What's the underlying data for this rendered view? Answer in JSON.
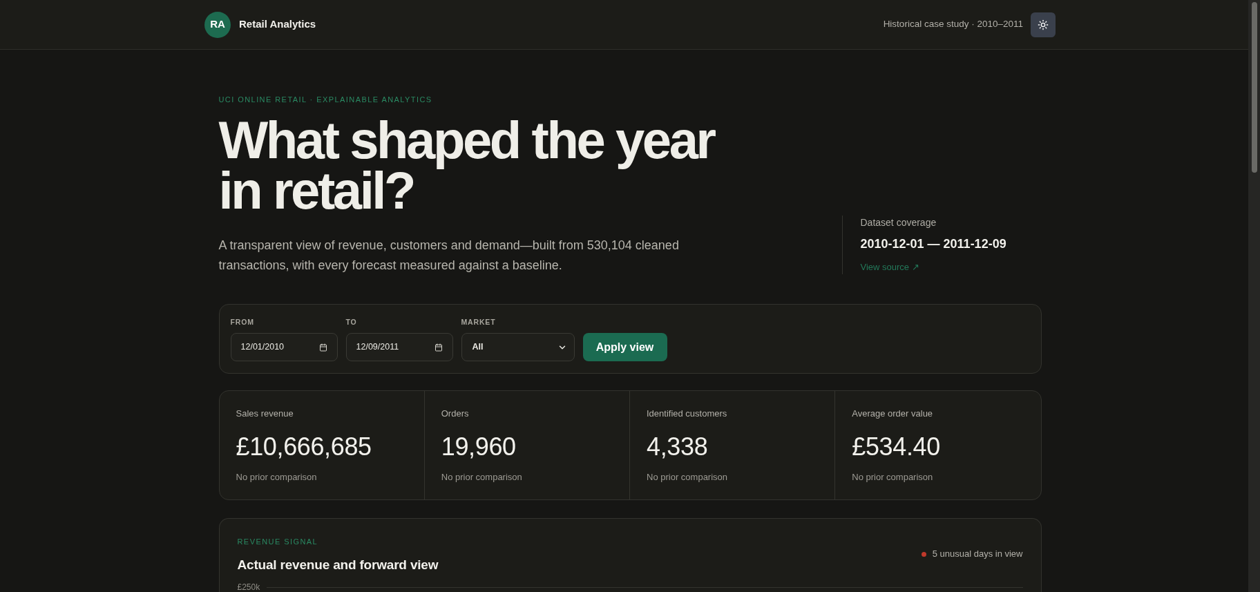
{
  "header": {
    "logo": "RA",
    "brand": "Retail Analytics",
    "case_study": "Historical case study · 2010–2011"
  },
  "hero": {
    "eyebrow": "UCI ONLINE RETAIL · EXPLAINABLE ANALYTICS",
    "headline": "What shaped the year in retail?",
    "description": "A transparent view of revenue, customers and demand—built from 530,104 cleaned transactions, with every forecast measured against a baseline."
  },
  "coverage": {
    "label": "Dataset coverage",
    "range": "2010-12-01 — 2011-12-09",
    "link": "View source ↗"
  },
  "filters": {
    "fields": [
      {
        "kind": "date",
        "label": "FROM",
        "value": "12/01/2010"
      },
      {
        "kind": "date",
        "label": "TO",
        "value": "12/09/2011"
      },
      {
        "kind": "select",
        "label": "MARKET",
        "value": "All"
      }
    ],
    "button": "Apply view"
  },
  "kpis": [
    {
      "label": "Sales revenue",
      "value": "£10,666,685",
      "note": "No prior comparison"
    },
    {
      "label": "Orders",
      "value": "19,960",
      "note": "No prior comparison"
    },
    {
      "label": "Identified customers",
      "value": "4,338",
      "note": "No prior comparison"
    },
    {
      "label": "Average order value",
      "value": "£534.40",
      "note": "No prior comparison"
    }
  ],
  "revenue_signal": {
    "eyebrow": "REVENUE SIGNAL",
    "title": "Actual revenue and forward view",
    "anomalies": "5 unusual days in view",
    "y_axis_labels": [
      "£250k"
    ]
  }
}
